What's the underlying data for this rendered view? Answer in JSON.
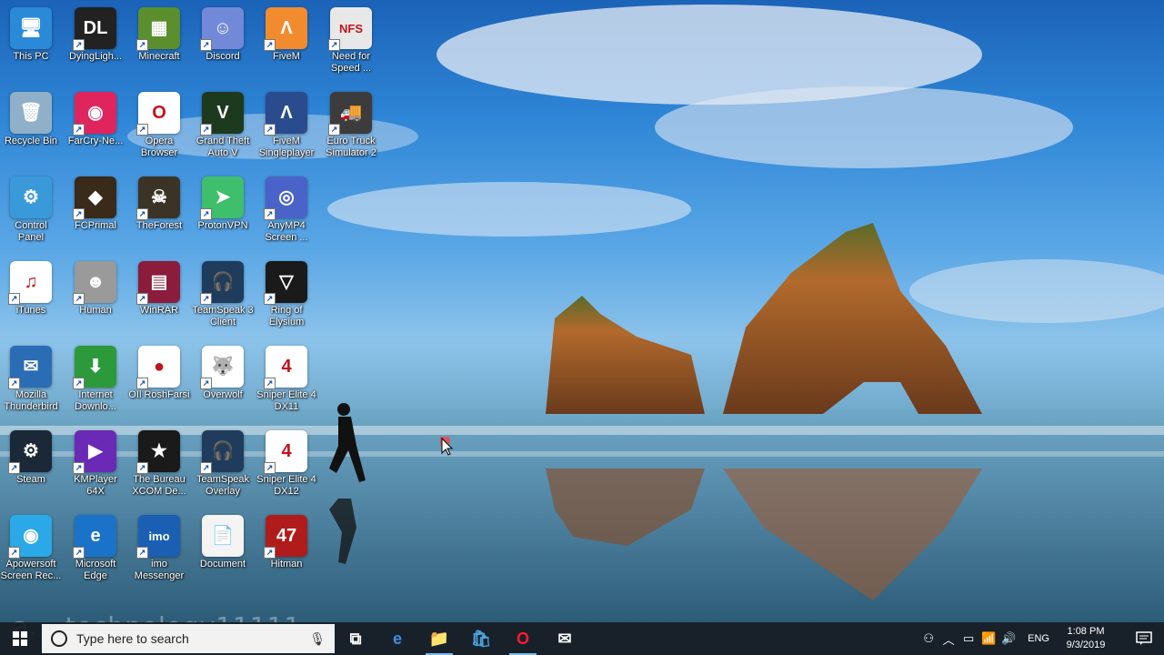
{
  "desktop": {
    "icons": [
      {
        "label": "This PC",
        "color": "#2a8ad8",
        "glyph": "🖥",
        "col": 0,
        "row": 0,
        "shortcut": false
      },
      {
        "label": "DyingLigh...",
        "color": "#222222",
        "glyph": "DL",
        "col": 1,
        "row": 0,
        "shortcut": true
      },
      {
        "label": "Minecraft",
        "color": "#5b8f2e",
        "glyph": "▦",
        "col": 2,
        "row": 0,
        "shortcut": true
      },
      {
        "label": "Discord",
        "color": "#7289da",
        "glyph": "☺",
        "col": 3,
        "row": 0,
        "shortcut": true
      },
      {
        "label": "FiveM",
        "color": "#f28b2e",
        "glyph": "Λ",
        "col": 4,
        "row": 0,
        "shortcut": true
      },
      {
        "label": "Need for\nSpeed ...",
        "color": "#e8e8e8",
        "glyph": "NFS",
        "col": 5,
        "row": 0,
        "shortcut": true
      },
      {
        "label": "Recycle Bin",
        "color": "#8fb0c8",
        "glyph": "🗑",
        "col": 0,
        "row": 1,
        "shortcut": false
      },
      {
        "label": "FarCry-Ne...",
        "color": "#e0245e",
        "glyph": "◉",
        "col": 1,
        "row": 1,
        "shortcut": true
      },
      {
        "label": "Opera\nBrowser",
        "color": "#ffffff",
        "glyph": "O",
        "col": 2,
        "row": 1,
        "shortcut": true
      },
      {
        "label": "Grand Theft\nAuto V",
        "color": "#1e3a1e",
        "glyph": "V",
        "col": 3,
        "row": 1,
        "shortcut": true
      },
      {
        "label": "FiveM\nSingleplayer",
        "color": "#2a4b8d",
        "glyph": "Λ",
        "col": 4,
        "row": 1,
        "shortcut": true
      },
      {
        "label": "Euro Truck\nSimulator 2",
        "color": "#3c3c3c",
        "glyph": "🚚",
        "col": 5,
        "row": 1,
        "shortcut": true
      },
      {
        "label": "Control\nPanel",
        "color": "#3a9ad9",
        "glyph": "⚙",
        "col": 0,
        "row": 2,
        "shortcut": false
      },
      {
        "label": "FCPrimal",
        "color": "#3a2a1a",
        "glyph": "◆",
        "col": 1,
        "row": 2,
        "shortcut": true
      },
      {
        "label": "TheForest",
        "color": "#3b3325",
        "glyph": "☠",
        "col": 2,
        "row": 2,
        "shortcut": true
      },
      {
        "label": "ProtonVPN",
        "color": "#3fbf6b",
        "glyph": "➤",
        "col": 3,
        "row": 2,
        "shortcut": true
      },
      {
        "label": "AnyMP4\nScreen ...",
        "color": "#4a63c8",
        "glyph": "◎",
        "col": 4,
        "row": 2,
        "shortcut": true
      },
      {
        "label": "iTunes",
        "color": "#ffffff",
        "glyph": "♫",
        "col": 0,
        "row": 3,
        "shortcut": true
      },
      {
        "label": "Human",
        "color": "#9a9a9a",
        "glyph": "☻",
        "col": 1,
        "row": 3,
        "shortcut": true
      },
      {
        "label": "WinRAR",
        "color": "#8b1c3c",
        "glyph": "▤",
        "col": 2,
        "row": 3,
        "shortcut": true
      },
      {
        "label": "TeamSpeak 3\nClient",
        "color": "#1f3c5c",
        "glyph": "🎧",
        "col": 3,
        "row": 3,
        "shortcut": true
      },
      {
        "label": "Ring of\nElysium",
        "color": "#1a1a1a",
        "glyph": "▽",
        "col": 4,
        "row": 3,
        "shortcut": true
      },
      {
        "label": "Mozilla\nThunderbird",
        "color": "#2a6db5",
        "glyph": "✉",
        "col": 0,
        "row": 4,
        "shortcut": true
      },
      {
        "label": "Internet\nDownlo...",
        "color": "#2c9a3a",
        "glyph": "⬇",
        "col": 1,
        "row": 4,
        "shortcut": true
      },
      {
        "label": "OIl RoshFarsi",
        "color": "#ffffff",
        "glyph": "●",
        "col": 2,
        "row": 4,
        "shortcut": true
      },
      {
        "label": "Overwolf",
        "color": "#ffffff",
        "glyph": "🐺",
        "col": 3,
        "row": 4,
        "shortcut": true
      },
      {
        "label": "Sniper Elite 4\nDX11",
        "color": "#ffffff",
        "glyph": "4",
        "col": 4,
        "row": 4,
        "shortcut": true
      },
      {
        "label": "Steam",
        "color": "#1b2838",
        "glyph": "⚙",
        "col": 0,
        "row": 5,
        "shortcut": true
      },
      {
        "label": "KMPlayer\n64X",
        "color": "#6a2ab5",
        "glyph": "▶",
        "col": 1,
        "row": 5,
        "shortcut": true
      },
      {
        "label": "The Bureau\nXCOM De...",
        "color": "#1a1a1a",
        "glyph": "★",
        "col": 2,
        "row": 5,
        "shortcut": true
      },
      {
        "label": "TeamSpeak\nOverlay",
        "color": "#1f3c5c",
        "glyph": "🎧",
        "col": 3,
        "row": 5,
        "shortcut": true
      },
      {
        "label": "Sniper Elite 4\nDX12",
        "color": "#ffffff",
        "glyph": "4",
        "col": 4,
        "row": 5,
        "shortcut": true
      },
      {
        "label": "Apowersoft\nScreen Rec...",
        "color": "#2aa8e8",
        "glyph": "◉",
        "col": 0,
        "row": 6,
        "shortcut": true
      },
      {
        "label": "Microsoft\nEdge",
        "color": "#1a73c8",
        "glyph": "e",
        "col": 1,
        "row": 6,
        "shortcut": true
      },
      {
        "label": "imo\nMessenger",
        "color": "#1a5fb4",
        "glyph": "imo",
        "col": 2,
        "row": 6,
        "shortcut": true
      },
      {
        "label": "Document",
        "color": "#f4f4f4",
        "glyph": "📄",
        "col": 3,
        "row": 6,
        "shortcut": false
      },
      {
        "label": "Hitman",
        "color": "#b01c1c",
        "glyph": "47",
        "col": 4,
        "row": 6,
        "shortcut": true
      }
    ]
  },
  "watermark": "a... technology11111",
  "taskbar": {
    "search_placeholder": "Type here to search",
    "pinned": [
      {
        "name": "task-view",
        "glyph": "⧉",
        "active": false
      },
      {
        "name": "edge",
        "glyph": "e",
        "active": false
      },
      {
        "name": "file-explorer",
        "glyph": "📁",
        "active": true
      },
      {
        "name": "store",
        "glyph": "🛍",
        "active": false
      },
      {
        "name": "opera",
        "glyph": "O",
        "active": true
      },
      {
        "name": "mail",
        "glyph": "✉",
        "active": false
      }
    ],
    "tray": {
      "language": "ENG",
      "time": "1:08 PM",
      "date": "9/3/2019"
    }
  },
  "colors": {
    "taskbar": "#181e26",
    "accent": "#76b9ed"
  }
}
